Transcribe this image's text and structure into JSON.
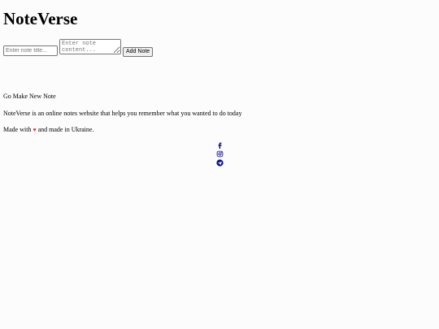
{
  "app": {
    "title": "NoteVerse"
  },
  "form": {
    "title_placeholder": "Enter note title...",
    "title_value": "",
    "content_placeholder": "Enter note content...",
    "content_value": "",
    "add_button_label": "Add Note"
  },
  "notes": {
    "heading": "Go Make New Note"
  },
  "footer": {
    "about": "NoteVerse is an online notes website that helps you remember what you wanted to do today",
    "made_prefix": "Made with ",
    "heart": "♥",
    "made_suffix": " and made in Ukraine."
  },
  "social": {
    "icons": [
      "facebook-icon",
      "instagram-icon",
      "telegram-icon"
    ],
    "icon_color": "#0b0b8f"
  },
  "colors": {
    "background": "#fcfcfc",
    "heart": "#e02b2b",
    "text": "#000000"
  }
}
